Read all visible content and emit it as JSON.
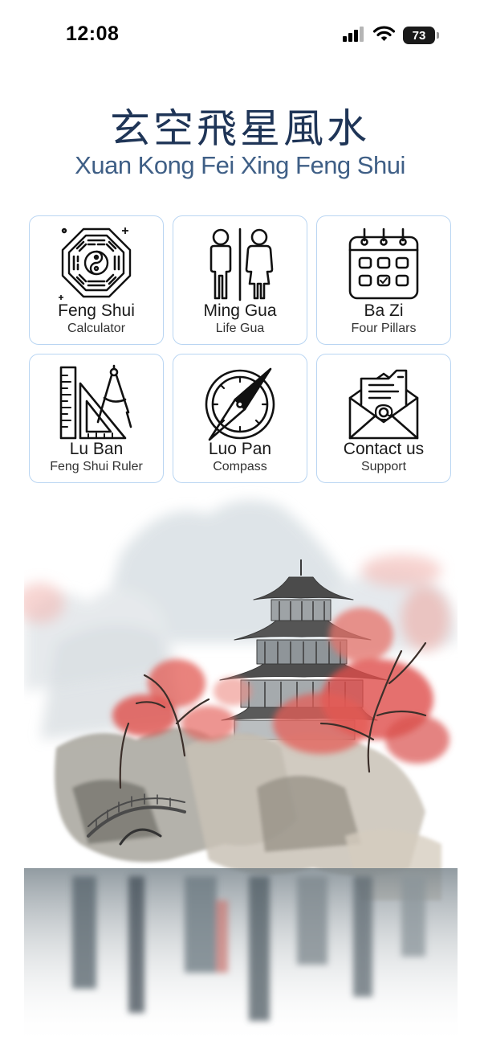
{
  "status_bar": {
    "time": "12:08",
    "battery": "73",
    "icons": [
      "signal-icon",
      "wifi-icon",
      "battery-icon"
    ]
  },
  "header": {
    "title_cn": "玄空飛星風水",
    "title_en": "Xuan Kong Fei Xing Feng Shui"
  },
  "menu": [
    {
      "title": "Feng Shui",
      "subtitle": "Calculator",
      "icon": "bagua-icon"
    },
    {
      "title": "Ming Gua",
      "subtitle": "Life Gua",
      "icon": "man-woman-icon"
    },
    {
      "title": "Ba Zi",
      "subtitle": "Four Pillars",
      "icon": "calendar-icon"
    },
    {
      "title": "Lu Ban",
      "subtitle": "Feng Shui Ruler",
      "icon": "ruler-compass-icon"
    },
    {
      "title": "Luo Pan",
      "subtitle": "Compass",
      "icon": "compass-icon"
    },
    {
      "title": "Contact us",
      "subtitle": "Support",
      "icon": "mail-icon"
    }
  ],
  "colors": {
    "title": "#1f3557",
    "subtitle": "#3f5f86",
    "tile_border": "#b9d5f2",
    "blossom": "#e05a5a"
  },
  "illustration": "ink-painting-pagoda"
}
